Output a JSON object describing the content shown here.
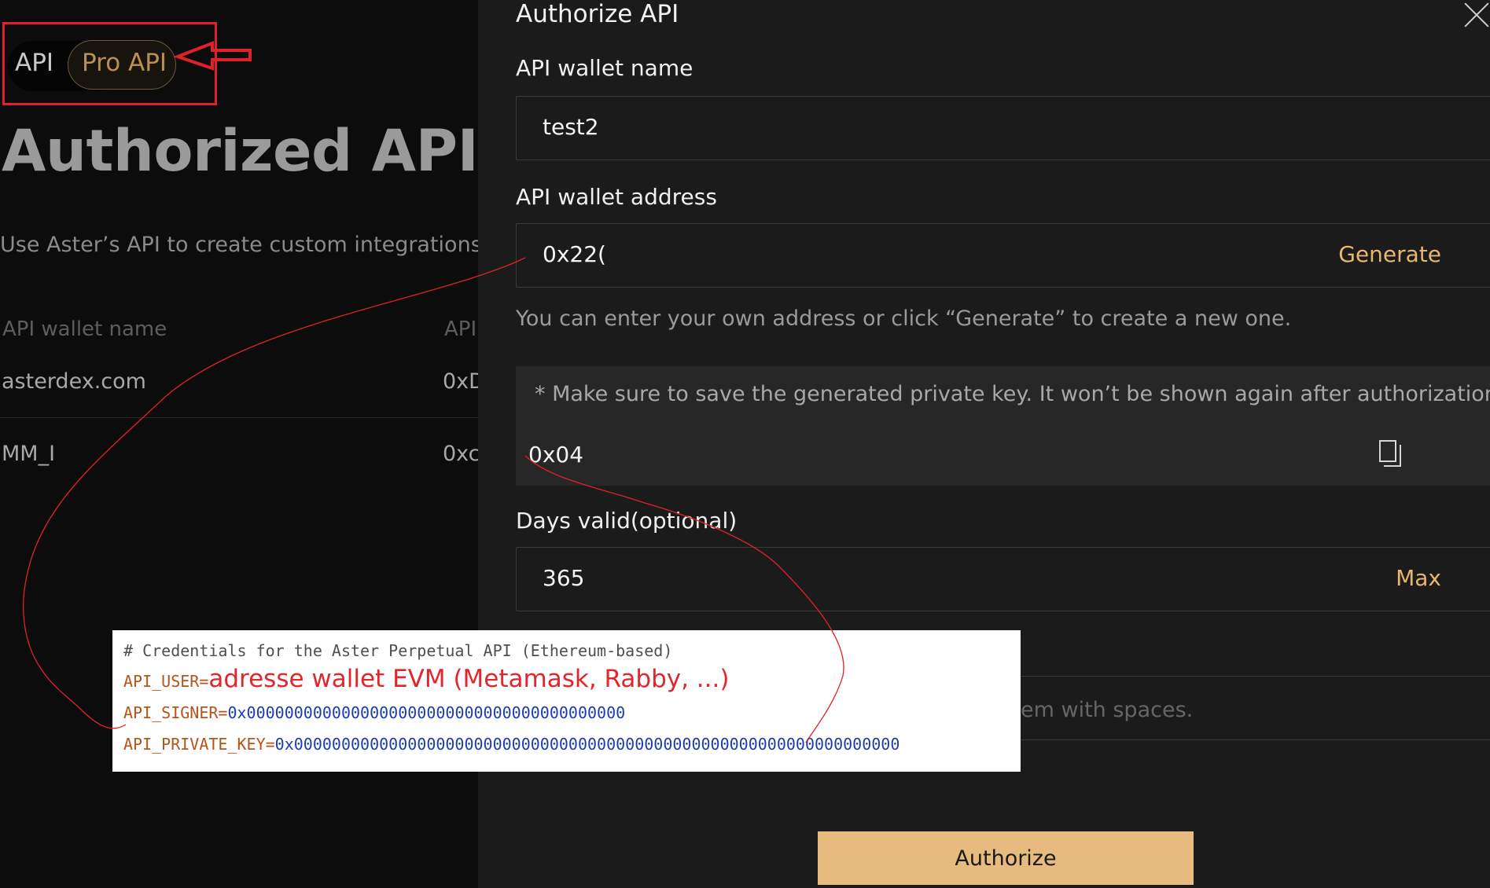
{
  "left": {
    "tabs": [
      "API",
      "Pro API"
    ],
    "title": "Authorized API wa",
    "description": "Use Aster’s API to create custom integrations and",
    "table_headers": [
      "API wallet name",
      "API"
    ],
    "rows": [
      {
        "name": "asterdex.com",
        "address": "0xD"
      },
      {
        "name": "MM_I",
        "address": "0xc"
      }
    ]
  },
  "modal": {
    "title": "Authorize API",
    "wallet_name_label": "API wallet name",
    "wallet_name_value": "test2",
    "wallet_address_label": "API wallet address",
    "wallet_address_value": "0x22(",
    "generate_label": "Generate",
    "address_hint": "You can enter your own address or click “Generate” to create a new one.",
    "warning_star": "*",
    "warning": "Make sure to save the generated private key. It won’t be shown again after authorization.",
    "private_key_value": "0x04",
    "days_label": "Days valid(optional)",
    "days_value": "365",
    "max_label": "Max",
    "partial_hint": "em with spaces.",
    "authorize_label": "Authorize"
  },
  "code_overlay": {
    "comment": "# Credentials for the Aster Perpetual API (Ethereum-based)",
    "user_key": "API_USER=",
    "user_note": "adresse wallet EVM (Metamask, Rabby, ...)",
    "signer_key": "API_SIGNER=",
    "signer_value": "0x0000000000000000000000000000000000000000",
    "private_key_key": "API_PRIVATE_KEY=",
    "private_key_value": "0x0000000000000000000000000000000000000000000000000000000000000000"
  },
  "colors": {
    "accent": "#e7b66f",
    "annotation": "#e0202a",
    "button": "#e7bb7f"
  }
}
